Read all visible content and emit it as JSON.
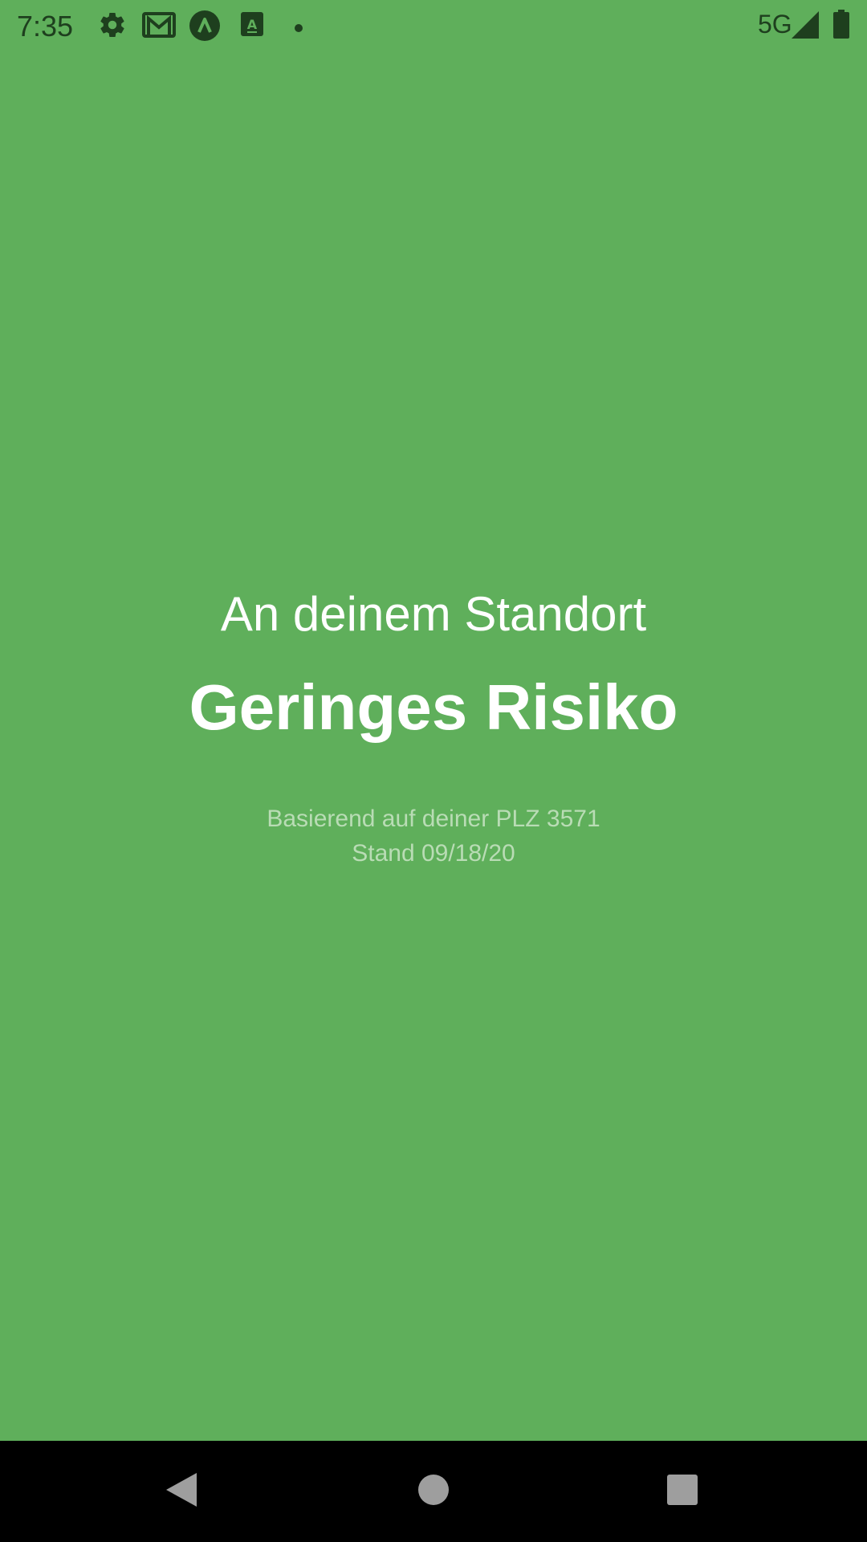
{
  "status_bar": {
    "time": "7:35",
    "network": "5G",
    "icons": [
      "gear-icon",
      "gmail-icon",
      "app-a-icon",
      "text-app-icon",
      "notification-dot-icon",
      "signal-icon",
      "battery-icon"
    ]
  },
  "risk": {
    "location_label": "An deinem Standort",
    "level": "Geringes Risiko",
    "based_on": "Basierend auf deiner PLZ 3571",
    "date": "Stand 09/18/20"
  },
  "colors": {
    "background": "#5faf5b",
    "muted_text": "#b9dcb5",
    "status_icons": "#1e3f1e"
  },
  "nav_bar": {
    "icons": [
      "back-icon",
      "home-icon",
      "recents-icon"
    ]
  }
}
